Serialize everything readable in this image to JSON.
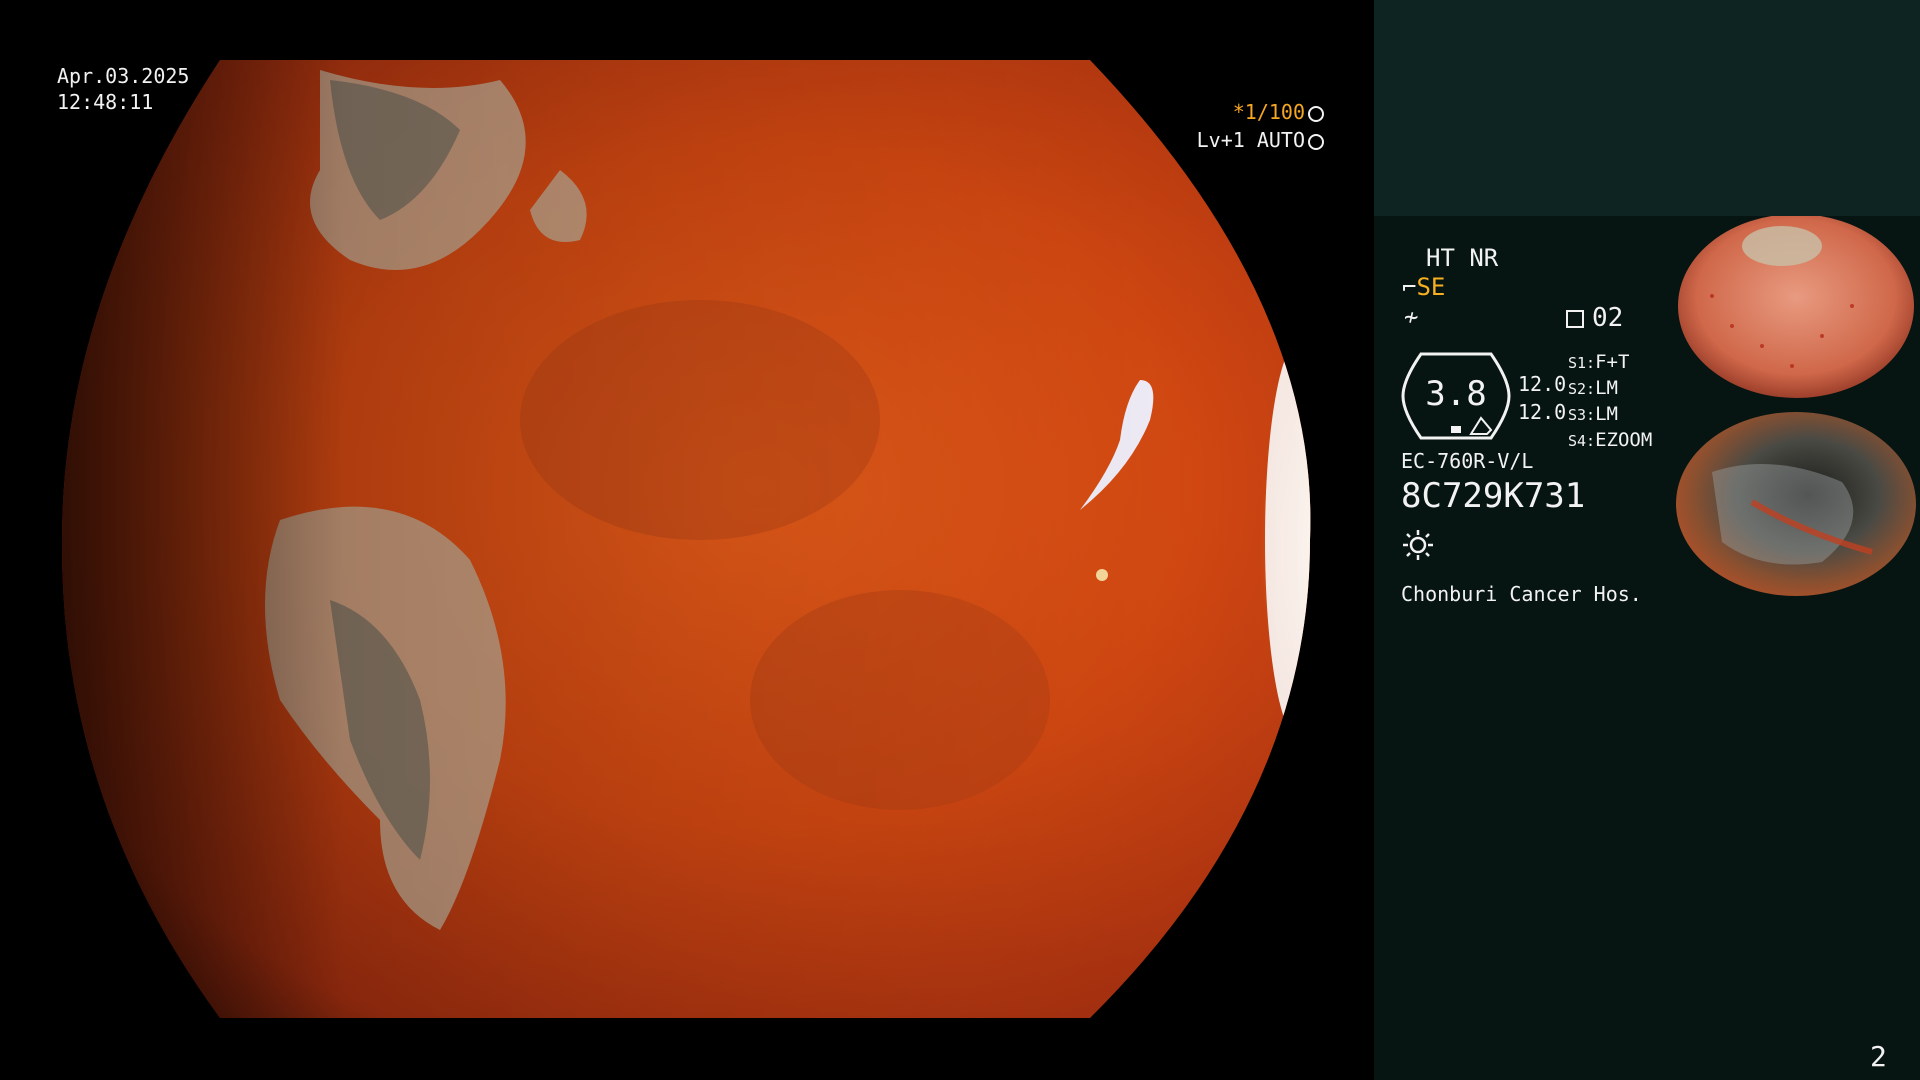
{
  "main_view": {
    "date": "Apr.03.2025",
    "time": "12:48:11",
    "shutter": "*1/100",
    "iris": "Lv+1 AUTO"
  },
  "side_panel": {
    "mode": "HT NR",
    "enhancement_value": "SE",
    "memory": "02",
    "gauge_value": "3.8",
    "settings_1": "12.0",
    "settings_2": "12.0",
    "switches": [
      {
        "key": "S1:",
        "value": "F+T"
      },
      {
        "key": "S2:",
        "value": "LM"
      },
      {
        "key": "S3:",
        "value": "LM"
      },
      {
        "key": "S4:",
        "value": "EZOOM"
      }
    ],
    "scope_model": "EC-760R-V/L",
    "scope_serial": "8C729K731",
    "hospital": "Chonburi Cancer Hos."
  },
  "page_number": "2",
  "colors": {
    "panel_bg": "#071512",
    "panel_top_bg": "#0e2423",
    "highlight": "#f6b020"
  },
  "icons": [
    "shutter-icon",
    "iris-icon",
    "enhancement-icon",
    "color-tone-icon",
    "memory-icon",
    "light-icon"
  ]
}
